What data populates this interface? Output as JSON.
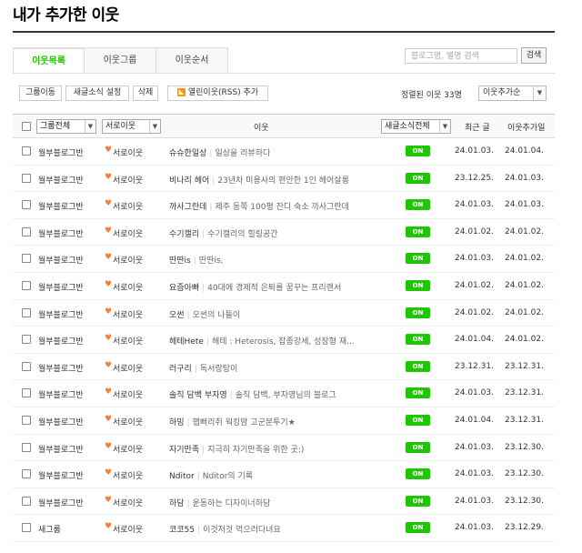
{
  "page_title": "내가 추가한 이웃",
  "tabs": [
    "이웃목록",
    "이웃그룹",
    "이웃순서"
  ],
  "search": {
    "placeholder": "블로그명, 별명 검색",
    "button": "검색"
  },
  "toolbar": {
    "group_move": "그룹이동",
    "new_post_setting": "새글소식 설정",
    "delete": "삭제",
    "rss_add": "열린이웃(RSS) 추가",
    "rss_icon": "rss-icon"
  },
  "sort": {
    "label": "정렬된 이웃 33명",
    "selected": "이웃추가순"
  },
  "header": {
    "group_all": "그룹전체",
    "relation": "서로이웃",
    "neighbor": "이웃",
    "new_post_all": "새글소식전체",
    "recent_post": "최근 글",
    "added_date": "이웃추가일"
  },
  "colors": {
    "accent": "#1ec800",
    "heart": "#f5823a"
  },
  "rows": [
    {
      "group": "월부블로그반",
      "relation": "서로이웃",
      "nick": "슈슈한일상",
      "desc": "일상을 리뷰하다",
      "badge": "ON",
      "recent": "24.01.03.",
      "added": "24.01.04."
    },
    {
      "group": "월부블로그반",
      "relation": "서로이웃",
      "nick": "비나리 헤어",
      "desc": "23년차 미용사의 편안한 1인 헤어살롱",
      "badge": "ON",
      "recent": "23.12.25.",
      "added": "24.01.03."
    },
    {
      "group": "월부블로그반",
      "relation": "서로이웃",
      "nick": "까사그란데",
      "desc": "제주 동쪽 100평 잔디 숙소 까사그란데",
      "badge": "ON",
      "recent": "24.01.03.",
      "added": "24.01.03."
    },
    {
      "group": "월부블로그반",
      "relation": "서로이웃",
      "nick": "수기캘리",
      "desc": "수기캘리의 힐링공간",
      "badge": "ON",
      "recent": "24.01.02.",
      "added": "24.01.02."
    },
    {
      "group": "월부블로그반",
      "relation": "서로이웃",
      "nick": "딴딴is",
      "desc": "딴딴is,",
      "badge": "ON",
      "recent": "24.01.03.",
      "added": "24.01.02."
    },
    {
      "group": "월부블로그반",
      "relation": "서로이웃",
      "nick": "요즘아빠",
      "desc": "40대에 경제적 은퇴를 꿈꾸는 프리랜서",
      "badge": "ON",
      "recent": "24.01.02.",
      "added": "24.01.02."
    },
    {
      "group": "월부블로그반",
      "relation": "서로이웃",
      "nick": "오썬",
      "desc": "오썬의 나들이",
      "badge": "ON",
      "recent": "24.01.02.",
      "added": "24.01.02."
    },
    {
      "group": "월부블로그반",
      "relation": "서로이웃",
      "nick": "헤테Hete",
      "desc": "해테 : Heterosis, 잡종강세, 성장형 재...",
      "badge": "ON",
      "recent": "24.01.04.",
      "added": "24.01.02."
    },
    {
      "group": "월부블로그반",
      "relation": "서로이웃",
      "nick": "러구리",
      "desc": "독서랑탕이",
      "badge": "ON",
      "recent": "23.12.31.",
      "added": "23.12.31."
    },
    {
      "group": "월부블로그반",
      "relation": "서로이웃",
      "nick": "솔직 담백 부자영",
      "desc": "솔직 담백, 부자영님의 블로그",
      "badge": "ON",
      "recent": "24.01.03.",
      "added": "23.12.31."
    },
    {
      "group": "월부블로그반",
      "relation": "서로이웃",
      "nick": "하밍",
      "desc": "햅삐리취 웍킹맘 고군분투기★",
      "badge": "ON",
      "recent": "24.01.04.",
      "added": "23.12.31."
    },
    {
      "group": "월부블로그반",
      "relation": "서로이웃",
      "nick": "자기만족",
      "desc": "지극히 자기만족을 위한 곳:)",
      "badge": "ON",
      "recent": "24.01.03.",
      "added": "23.12.30."
    },
    {
      "group": "월부블로그반",
      "relation": "서로이웃",
      "nick": "Nditor",
      "desc": "Nditor의 기록",
      "badge": "ON",
      "recent": "24.01.03.",
      "added": "23.12.30."
    },
    {
      "group": "월부블로그반",
      "relation": "서로이웃",
      "nick": "하담",
      "desc": "운동하는 디자이너하담",
      "badge": "ON",
      "recent": "24.01.03.",
      "added": "23.12.30."
    },
    {
      "group": "새그룹",
      "relation": "서로이웃",
      "nick": "코코55",
      "desc": "이것저것 먹으러다녀요",
      "badge": "ON",
      "recent": "24.01.03.",
      "added": "23.12.29."
    }
  ]
}
